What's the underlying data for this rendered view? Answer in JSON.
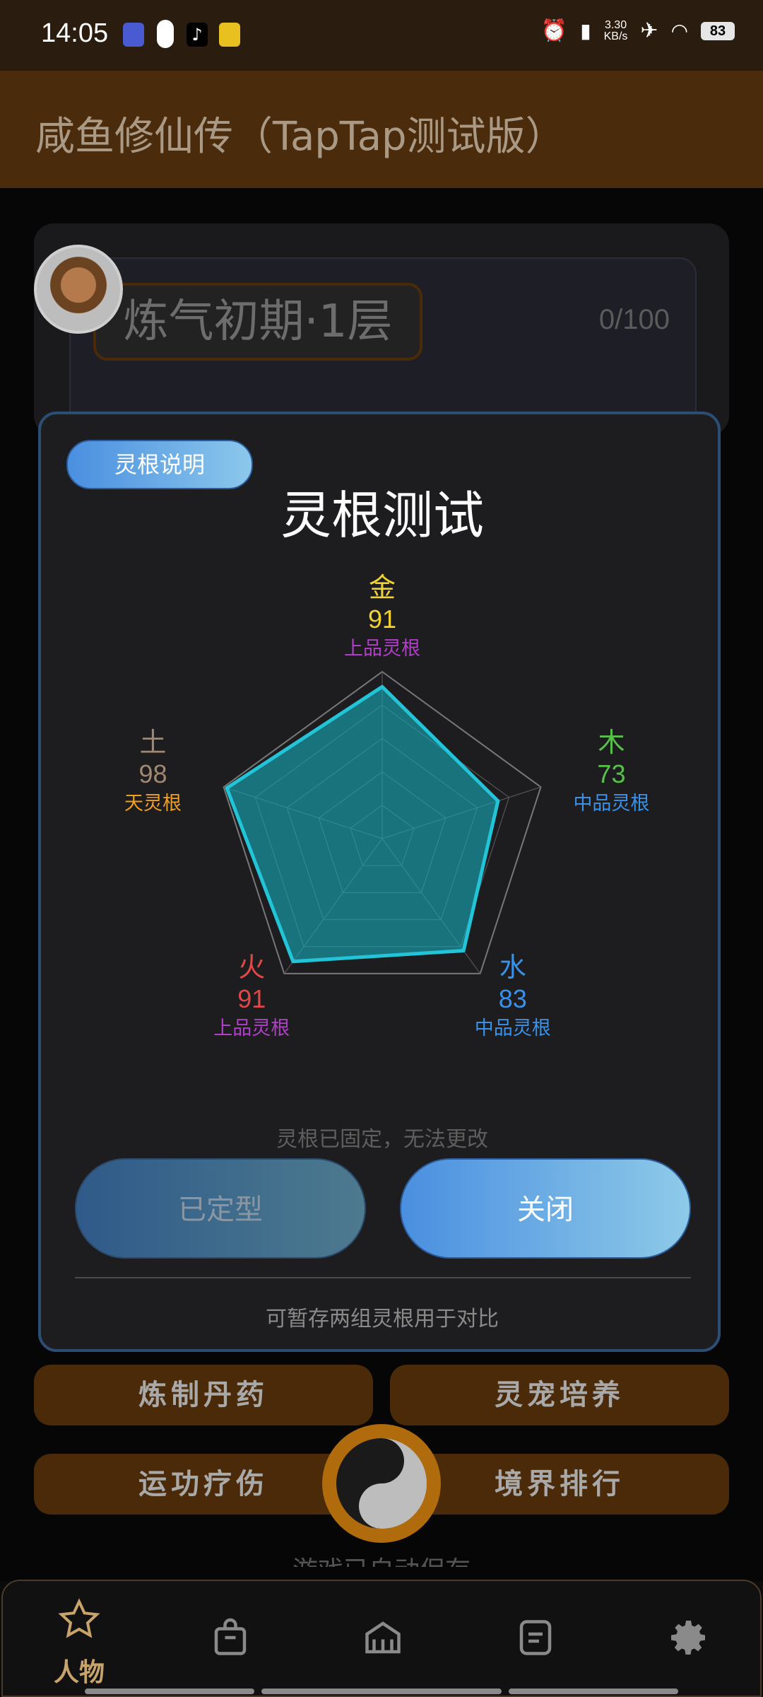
{
  "status_bar": {
    "time": "14:05",
    "net_speed_value": "3.30",
    "net_speed_unit": "KB/s",
    "battery": "83",
    "icons": [
      "app-icon-blue",
      "pill-icon",
      "tiktok-icon",
      "app-icon-yellow",
      "alarm-icon",
      "vibrate-icon",
      "airplane-icon",
      "wifi-icon",
      "battery-icon"
    ]
  },
  "app_title": "咸鱼修仙传（TapTap测试版）",
  "background": {
    "realm_label": "炼气初期·1层",
    "progress_text": "0/100",
    "buttons": [
      "炼制丹药",
      "灵宠培养",
      "运功疗伤",
      "境界排行"
    ],
    "cut_text": "游戏已自动保存"
  },
  "modal": {
    "desc_button": "灵根说明",
    "title": "灵根测试",
    "locked_hint": "灵根已固定，无法更改",
    "fixed_button": "已定型",
    "close_button": "关闭",
    "footnote": "可暂存两组灵根用于对比"
  },
  "chart_data": {
    "type": "radar",
    "max": 100,
    "axes": [
      {
        "name": "金",
        "value": 91,
        "grade": "上品灵根",
        "name_color": "#f2d230",
        "grade_color": "#b040c8"
      },
      {
        "name": "木",
        "value": 73,
        "grade": "中品灵根",
        "name_color": "#58c04a",
        "grade_color": "#3a92e8"
      },
      {
        "name": "水",
        "value": 83,
        "grade": "中品灵根",
        "name_color": "#3a92e8",
        "grade_color": "#3a92e8"
      },
      {
        "name": "火",
        "value": 91,
        "grade": "上品灵根",
        "name_color": "#e04848",
        "grade_color": "#b040c8"
      },
      {
        "name": "土",
        "value": 98,
        "grade": "天灵根",
        "name_color": "#a08870",
        "grade_color": "#f0a020"
      }
    ],
    "fill_color": "#17a8b8",
    "stroke_color": "#22c4d8"
  },
  "nav": {
    "items": [
      {
        "label": "人物",
        "icon": "star-icon"
      },
      {
        "label": "",
        "icon": "bag-icon"
      },
      {
        "label": "",
        "icon": "home-icon"
      },
      {
        "label": "",
        "icon": "list-icon"
      },
      {
        "label": "",
        "icon": "gear-icon"
      }
    ]
  }
}
